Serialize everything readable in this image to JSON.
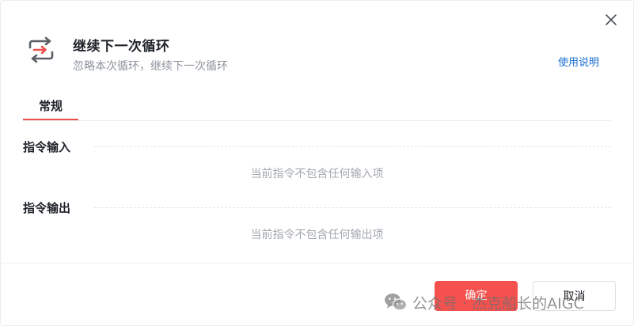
{
  "dialog": {
    "title": "继续下一次循环",
    "subtitle": "忽略本次循环，继续下一次循环",
    "help_link": "使用说明",
    "icon": "loop-continue-icon",
    "close_icon": "close-icon"
  },
  "tabs": [
    {
      "label": "常规",
      "active": true
    }
  ],
  "sections": {
    "input": {
      "label": "指令输入",
      "empty": "当前指令不包含任何输入项"
    },
    "output": {
      "label": "指令输出",
      "empty": "当前指令不包含任何输出项"
    }
  },
  "footer": {
    "confirm_label": "确定",
    "cancel_label": "取消"
  },
  "watermark": {
    "text": "公众号 · 杰克船长的AIGC",
    "icon": "wechat-icon"
  },
  "colors": {
    "accent": "#f5524f",
    "link": "#1a6fd0",
    "tab_indicator": "#f0504d"
  }
}
